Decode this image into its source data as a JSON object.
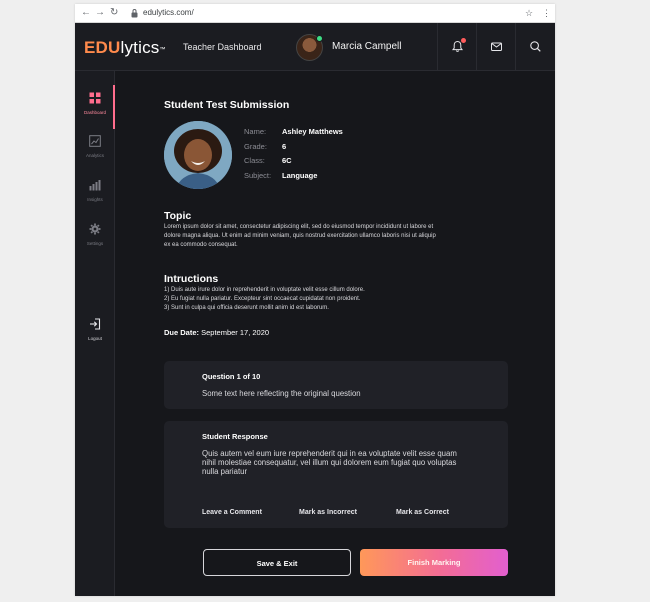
{
  "browser": {
    "url": "edulytics.com/"
  },
  "header": {
    "logo_main": "EDU",
    "logo_rest": "lytics",
    "logo_mark": "™",
    "title": "Teacher Dashboard",
    "user_name": "Marcia Campell"
  },
  "sidebar": {
    "items": [
      {
        "label": "Dashboard",
        "icon": "dashboard-grid-icon",
        "active": true
      },
      {
        "label": "Analytics",
        "icon": "analytics-chart-icon",
        "active": false
      },
      {
        "label": "Insights",
        "icon": "insights-bars-icon",
        "active": false
      },
      {
        "label": "Settings",
        "icon": "gear-icon",
        "active": false
      },
      {
        "label": "Logout",
        "icon": "logout-icon",
        "active": false
      }
    ]
  },
  "main": {
    "title": "Student Test Submission",
    "student": {
      "fields": [
        {
          "key": "Name:",
          "value": "Ashley Matthews"
        },
        {
          "key": "Grade:",
          "value": "6"
        },
        {
          "key": "Class:",
          "value": "6C"
        },
        {
          "key": "Subject:",
          "value": "Language"
        }
      ]
    },
    "topic": {
      "title": "Topic",
      "body": "Lorem ipsum dolor sit amet, consectetur adipiscing elit, sed do eiusmod tempor incididunt ut labore et dolore magna aliqua. Ut enim ad minim veniam, quis nostrud exercitation ullamco laboris nisi ut aliquip ex ea commodo consequat."
    },
    "instructions": {
      "title": "Intructions",
      "lines": [
        "1) Duis aute irure dolor in reprehenderit in voluptate velit esse cillum dolore.",
        "2) Eu fugiat nulla pariatur. Excepteur sint occaecat cupidatat non proident.",
        "3) Sunt in culpa qui officia deserunt mollit anim id est laborum."
      ]
    },
    "due_label": "Due Date:",
    "due_value": "September 17, 2020",
    "question": {
      "title": "Question 1 of 10",
      "text": "Some text here reflecting the original question"
    },
    "response": {
      "title": "Student Response",
      "text": "Quis autem vel eum iure reprehenderit qui in ea voluptate velit esse quam nihil molestiae consequatur, vel illum qui dolorem eum fugiat quo voluptas nulla pariatur",
      "actions": {
        "comment": "Leave a Comment",
        "incorrect": "Mark as Incorrect",
        "correct": "Mark as Correct"
      }
    },
    "buttons": {
      "save": "Save & Exit",
      "finish": "Finish Marking"
    }
  },
  "colors": {
    "accent_orange": "#ff8a4c",
    "accent_pink": "#e25fcf",
    "background": "#16171b",
    "card": "#202127",
    "online": "#3ddc84"
  }
}
